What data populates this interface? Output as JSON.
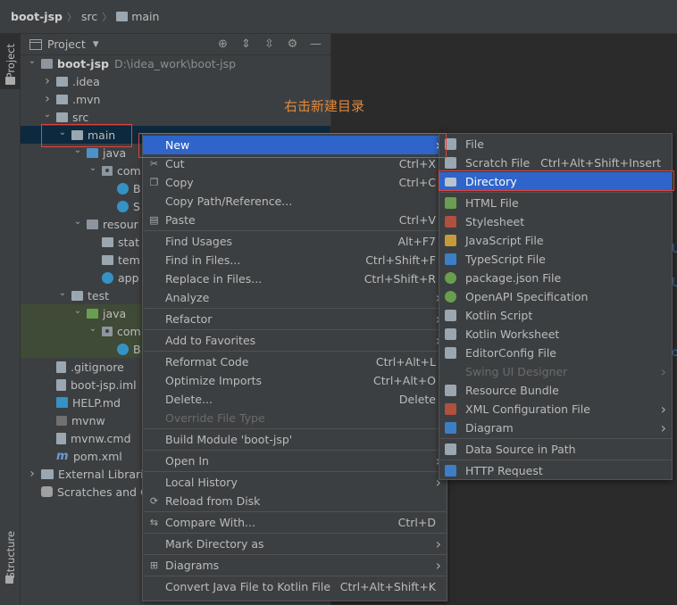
{
  "breadcrumb": {
    "root": "boot-jsp",
    "items": [
      "src",
      "main"
    ]
  },
  "left_strip": {
    "project_tab": "Project",
    "structure_tab": "Structure"
  },
  "project_panel": {
    "title": "Project",
    "tree": [
      {
        "label": "boot-jsp",
        "path": "D:\\idea_work\\boot-jsp",
        "indent": 0,
        "expanded": true,
        "icon": "folder-dark",
        "bold": true
      },
      {
        "label": ".idea",
        "indent": 1,
        "expanded": false,
        "icon": "folder"
      },
      {
        "label": ".mvn",
        "indent": 1,
        "expanded": false,
        "icon": "folder"
      },
      {
        "label": "src",
        "indent": 1,
        "expanded": true,
        "icon": "folder"
      },
      {
        "label": "main",
        "indent": 2,
        "expanded": true,
        "icon": "folder",
        "selected": true
      },
      {
        "label": "java",
        "indent": 3,
        "expanded": true,
        "icon": "folder-blue"
      },
      {
        "label": "com",
        "indent": 4,
        "expanded": true,
        "icon": "pkg"
      },
      {
        "label": "B",
        "indent": 5,
        "icon": "classic"
      },
      {
        "label": "S",
        "indent": 5,
        "icon": "classic"
      },
      {
        "label": "resour",
        "indent": 3,
        "expanded": true,
        "icon": "folder-dark"
      },
      {
        "label": "stat",
        "indent": 4,
        "icon": "folder"
      },
      {
        "label": "tem",
        "indent": 4,
        "icon": "folder"
      },
      {
        "label": "app",
        "indent": 4,
        "icon": "classic-o"
      },
      {
        "label": "test",
        "indent": 2,
        "expanded": true,
        "icon": "folder"
      },
      {
        "label": "java",
        "indent": 3,
        "expanded": true,
        "icon": "folder-green",
        "green": true
      },
      {
        "label": "com",
        "indent": 4,
        "expanded": true,
        "icon": "pkg",
        "green": true
      },
      {
        "label": "B",
        "indent": 5,
        "icon": "classic",
        "green": true
      },
      {
        "label": ".gitignore",
        "indent": 1,
        "icon": "file-ic"
      },
      {
        "label": "boot-jsp.iml",
        "indent": 1,
        "icon": "file-ic"
      },
      {
        "label": "HELP.md",
        "indent": 1,
        "icon": "file-md"
      },
      {
        "label": "mvnw",
        "indent": 1,
        "icon": "file-term"
      },
      {
        "label": "mvnw.cmd",
        "indent": 1,
        "icon": "file-ic"
      },
      {
        "label": "pom.xml",
        "indent": 1,
        "icon": "file-m"
      },
      {
        "label": "External Librari",
        "indent": 0,
        "expanded": false,
        "icon": "libs"
      },
      {
        "label": "Scratches and C",
        "indent": 0,
        "icon": "scratch"
      }
    ]
  },
  "annotation": "右击新建目录",
  "context_menu": {
    "items": [
      {
        "label": "New",
        "arrow": true,
        "highlighted": true
      },
      {
        "label": "Cut",
        "shortcut": "Ctrl+X",
        "icon": "cut-icon",
        "glyph": "✂"
      },
      {
        "label": "Copy",
        "shortcut": "Ctrl+C",
        "icon": "copy-icon",
        "glyph": "❐"
      },
      {
        "label": "Copy Path/Reference..."
      },
      {
        "label": "Paste",
        "shortcut": "Ctrl+V",
        "icon": "paste-icon",
        "glyph": "▤"
      },
      {
        "sep": true
      },
      {
        "label": "Find Usages",
        "shortcut": "Alt+F7"
      },
      {
        "label": "Find in Files...",
        "shortcut": "Ctrl+Shift+F"
      },
      {
        "label": "Replace in Files...",
        "shortcut": "Ctrl+Shift+R"
      },
      {
        "label": "Analyze",
        "arrow": true
      },
      {
        "sep": true
      },
      {
        "label": "Refactor",
        "arrow": true
      },
      {
        "sep": true
      },
      {
        "label": "Add to Favorites",
        "arrow": true
      },
      {
        "sep": true
      },
      {
        "label": "Reformat Code",
        "shortcut": "Ctrl+Alt+L"
      },
      {
        "label": "Optimize Imports",
        "shortcut": "Ctrl+Alt+O"
      },
      {
        "label": "Delete...",
        "shortcut": "Delete"
      },
      {
        "label": "Override File Type",
        "disabled": true
      },
      {
        "sep": true
      },
      {
        "label": "Build Module 'boot-jsp'"
      },
      {
        "sep": true
      },
      {
        "label": "Open In",
        "arrow": true
      },
      {
        "sep": true
      },
      {
        "label": "Local History",
        "arrow": true
      },
      {
        "label": "Reload from Disk",
        "icon": "reload-icon",
        "glyph": "⟳"
      },
      {
        "sep": true
      },
      {
        "label": "Compare With...",
        "shortcut": "Ctrl+D",
        "icon": "compare-icon",
        "glyph": "⇆"
      },
      {
        "sep": true
      },
      {
        "label": "Mark Directory as",
        "arrow": true
      },
      {
        "sep": true
      },
      {
        "label": "Diagrams",
        "arrow": true,
        "icon": "diagrams-icon",
        "glyph": "⊞"
      },
      {
        "sep": true
      },
      {
        "label": "Convert Java File to Kotlin File",
        "shortcut": "Ctrl+Alt+Shift+K"
      }
    ]
  },
  "new_menu": {
    "items": [
      {
        "label": "File",
        "icon": "file-icon",
        "color": "#9aa7b0"
      },
      {
        "label": "Scratch File",
        "shortcut": "Ctrl+Alt+Shift+Insert",
        "icon": "scratch-file-icon",
        "color": "#9aa7b0"
      },
      {
        "label": "Directory",
        "icon": "directory-icon",
        "color": "#9aa7b0",
        "highlighted": true
      },
      {
        "sep": true
      },
      {
        "label": "HTML File",
        "icon": "html-file-icon",
        "color": "#6a9e4f"
      },
      {
        "label": "Stylesheet",
        "icon": "stylesheet-icon",
        "color": "#b0503f"
      },
      {
        "label": "JavaScript File",
        "icon": "javascript-file-icon",
        "color": "#c69a3b"
      },
      {
        "label": "TypeScript File",
        "icon": "typescript-file-icon",
        "color": "#3d7ec9"
      },
      {
        "label": "package.json File",
        "icon": "package-json-icon",
        "color": "#6a9e4f"
      },
      {
        "label": "OpenAPI Specification",
        "icon": "openapi-icon",
        "color": "#6a9e4f"
      },
      {
        "label": "Kotlin Script",
        "icon": "kotlin-script-icon",
        "color": "#9aa7b0"
      },
      {
        "label": "Kotlin Worksheet",
        "icon": "kotlin-worksheet-icon",
        "color": "#9aa7b0"
      },
      {
        "label": "EditorConfig File",
        "icon": "editorconfig-icon",
        "color": "#9aa7b0"
      },
      {
        "label": "Swing UI Designer",
        "arrow": true,
        "disabled": true
      },
      {
        "label": "Resource Bundle",
        "icon": "resource-bundle-icon",
        "color": "#9aa7b0"
      },
      {
        "label": "XML Configuration File",
        "arrow": true,
        "icon": "xml-config-icon",
        "color": "#b0503f"
      },
      {
        "label": "Diagram",
        "arrow": true,
        "icon": "diagram-icon",
        "color": "#3d7ec9"
      },
      {
        "sep": true
      },
      {
        "label": "Data Source in Path",
        "icon": "data-source-icon",
        "color": "#9aa7b0"
      },
      {
        "sep": true
      },
      {
        "label": "HTTP Request",
        "icon": "http-request-icon",
        "color": "#3d7ec9"
      }
    ]
  },
  "colors": {
    "highlight": "#2f65ca",
    "annotation": "#e0883b",
    "red_box": "#e0433a",
    "selection": "#0d293e"
  }
}
